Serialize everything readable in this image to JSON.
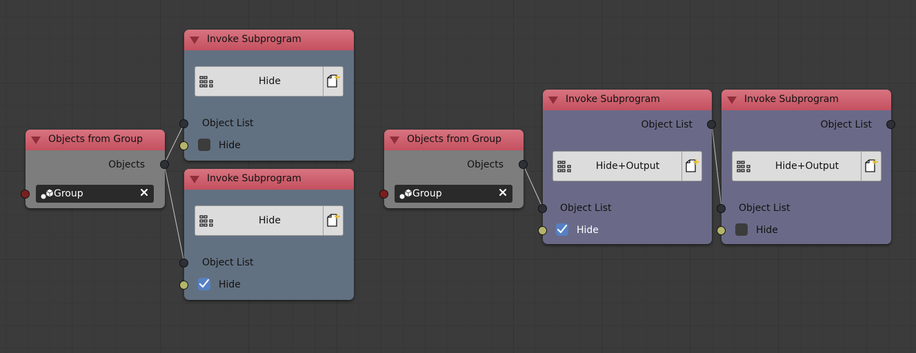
{
  "nodes": {
    "objects_from_group_1": {
      "title": "Objects from Group",
      "output_label": "Objects",
      "group_value": "Group"
    },
    "invoke_1": {
      "title": "Invoke Subprogram",
      "subprogram_name": "Hide",
      "input_label": "Object List",
      "checkbox_label": "Hide",
      "checked": false
    },
    "invoke_2": {
      "title": "Invoke Subprogram",
      "subprogram_name": "Hide",
      "input_label": "Object List",
      "checkbox_label": "Hide",
      "checked": true
    },
    "objects_from_group_2": {
      "title": "Objects from Group",
      "output_label": "Objects",
      "group_value": "Group"
    },
    "invoke_3": {
      "title": "Invoke Subprogram",
      "output_label": "Object List",
      "subprogram_name": "Hide+Output",
      "input_label": "Object List",
      "checkbox_label": "Hide",
      "checked": true
    },
    "invoke_4": {
      "title": "Invoke Subprogram",
      "output_label": "Object List",
      "subprogram_name": "Hide+Output",
      "input_label": "Object List",
      "checkbox_label": "Hide",
      "checked": false
    }
  },
  "icons": {
    "collapse": "triangle-down-icon",
    "subprogram": "node-tree-icon",
    "new": "new-file-icon",
    "group": "group-icon",
    "clear": "x-icon"
  },
  "colors": {
    "header": "#c4505f",
    "invoke_body_a": "#627181",
    "invoke_body_b": "#6a6a88",
    "group_body": "#7d7d7d",
    "checkbox_checked": "#5680c2"
  }
}
